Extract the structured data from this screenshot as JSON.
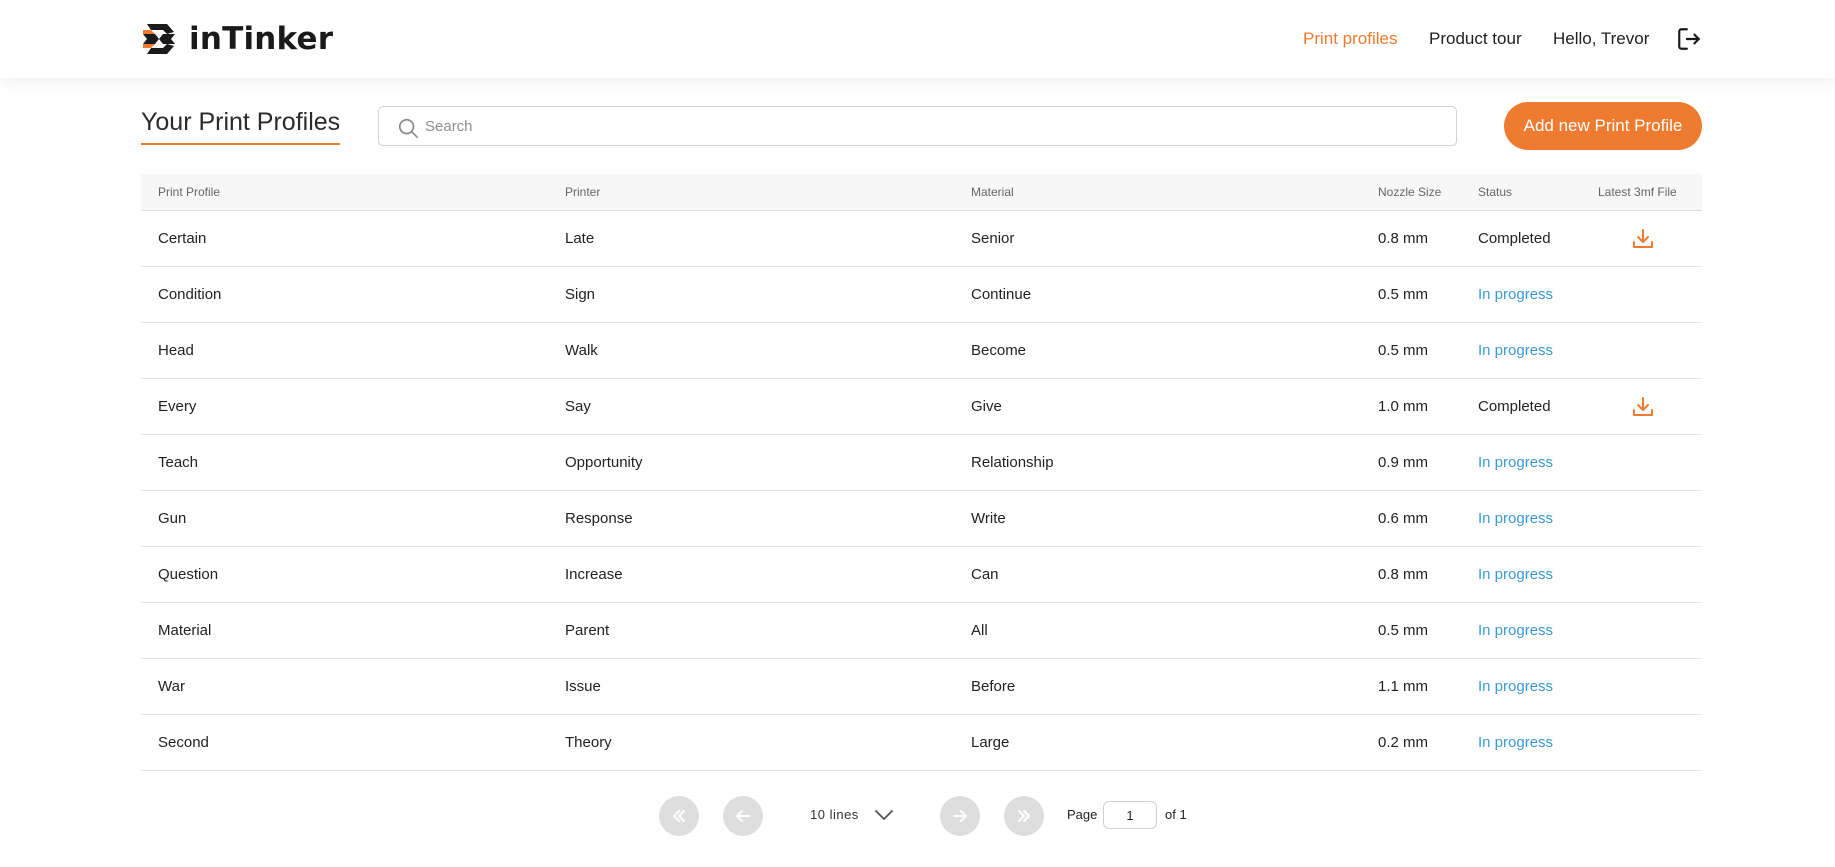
{
  "app": {
    "name": "inTinker"
  },
  "nav": {
    "print_profiles": "Print profiles",
    "product_tour": "Product tour",
    "greeting": "Hello, Trevor"
  },
  "colors": {
    "accent": "#ee7b2f",
    "in_progress": "#3a9ad9"
  },
  "icons": {
    "logo": "intinker-logo-icon",
    "logout": "logout-icon",
    "search": "search-icon",
    "download": "download-icon"
  },
  "page": {
    "title": "Your Print Profiles"
  },
  "search": {
    "placeholder": "Search",
    "value": ""
  },
  "add_button": "Add new Print Profile",
  "table": {
    "headers": [
      "Print Profile",
      "Printer",
      "Material",
      "Nozzle Size",
      "Status",
      "Latest 3mf File"
    ],
    "rows": [
      {
        "profile": "Certain",
        "printer": "Late",
        "material": "Senior",
        "nozzle": "0.8 mm",
        "status": "Completed",
        "has_file": true
      },
      {
        "profile": "Condition",
        "printer": "Sign",
        "material": "Continue",
        "nozzle": "0.5 mm",
        "status": "In progress",
        "has_file": false
      },
      {
        "profile": "Head",
        "printer": "Walk",
        "material": "Become",
        "nozzle": "0.5 mm",
        "status": "In progress",
        "has_file": false
      },
      {
        "profile": "Every",
        "printer": "Say",
        "material": "Give",
        "nozzle": "1.0 mm",
        "status": "Completed",
        "has_file": true
      },
      {
        "profile": "Teach",
        "printer": "Opportunity",
        "material": "Relationship",
        "nozzle": "0.9 mm",
        "status": "In progress",
        "has_file": false
      },
      {
        "profile": "Gun",
        "printer": "Response",
        "material": "Write",
        "nozzle": "0.6 mm",
        "status": "In progress",
        "has_file": false
      },
      {
        "profile": "Question",
        "printer": "Increase",
        "material": "Can",
        "nozzle": "0.8 mm",
        "status": "In progress",
        "has_file": false
      },
      {
        "profile": "Material",
        "printer": "Parent",
        "material": "All",
        "nozzle": "0.5 mm",
        "status": "In progress",
        "has_file": false
      },
      {
        "profile": "War",
        "printer": "Issue",
        "material": "Before",
        "nozzle": "1.1 mm",
        "status": "In progress",
        "has_file": false
      },
      {
        "profile": "Second",
        "printer": "Theory",
        "material": "Large",
        "nozzle": "0.2 mm",
        "status": "In progress",
        "has_file": false
      }
    ]
  },
  "pagination": {
    "lines_label": "10 lines",
    "page_label": "Page",
    "page_value": "1",
    "of_label": "of 1"
  }
}
